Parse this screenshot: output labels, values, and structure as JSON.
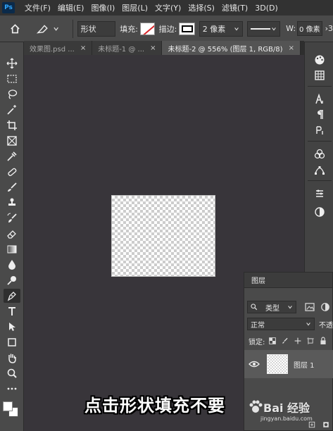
{
  "app": {
    "logo_text": "Ps"
  },
  "menu": [
    "文件(F)",
    "编辑(E)",
    "图像(I)",
    "图层(L)",
    "文字(Y)",
    "选择(S)",
    "滤镜(T)",
    "3D(D)"
  ],
  "options_bar": {
    "mode": "形状",
    "fill_label": "填充:",
    "stroke_label": "描边:",
    "stroke_width": "2 像素",
    "w_label": "W:",
    "w_value": "0 像素",
    "overflow_mark": "›3",
    "fill_state": "none"
  },
  "tabs": [
    {
      "label": "效果图.psd ...",
      "close": "×",
      "active": false
    },
    {
      "label": "未标题-1 @ ...",
      "close": "×",
      "active": false
    },
    {
      "label": "未标题-2 @ 556% (图层 1, RGB/8)",
      "close": "×",
      "active": true
    }
  ],
  "tools": [
    "move-tool",
    "marquee-tool",
    "lasso-tool",
    "magic-wand-tool",
    "crop-tool",
    "frame-tool",
    "eyedropper-tool",
    "healing-tool",
    "brush-tool",
    "stamp-tool",
    "history-brush-tool",
    "eraser-tool",
    "gradient-tool",
    "blur-tool",
    "dodge-tool",
    "pen-tool",
    "type-tool",
    "path-select-tool",
    "shape-tool",
    "hand-tool",
    "zoom-tool",
    "more-tools"
  ],
  "active_tool": "pen-tool",
  "layers_panel": {
    "title": "图层",
    "filter": "类型",
    "blend_mode": "正常",
    "opacity_label": "不透",
    "lock_label": "锁定:",
    "layer_name": "图层 1"
  },
  "subtitle": "点击形状填充不要",
  "watermark": {
    "text": "Bai 经验",
    "sub": "jingyan.baidu.com"
  }
}
